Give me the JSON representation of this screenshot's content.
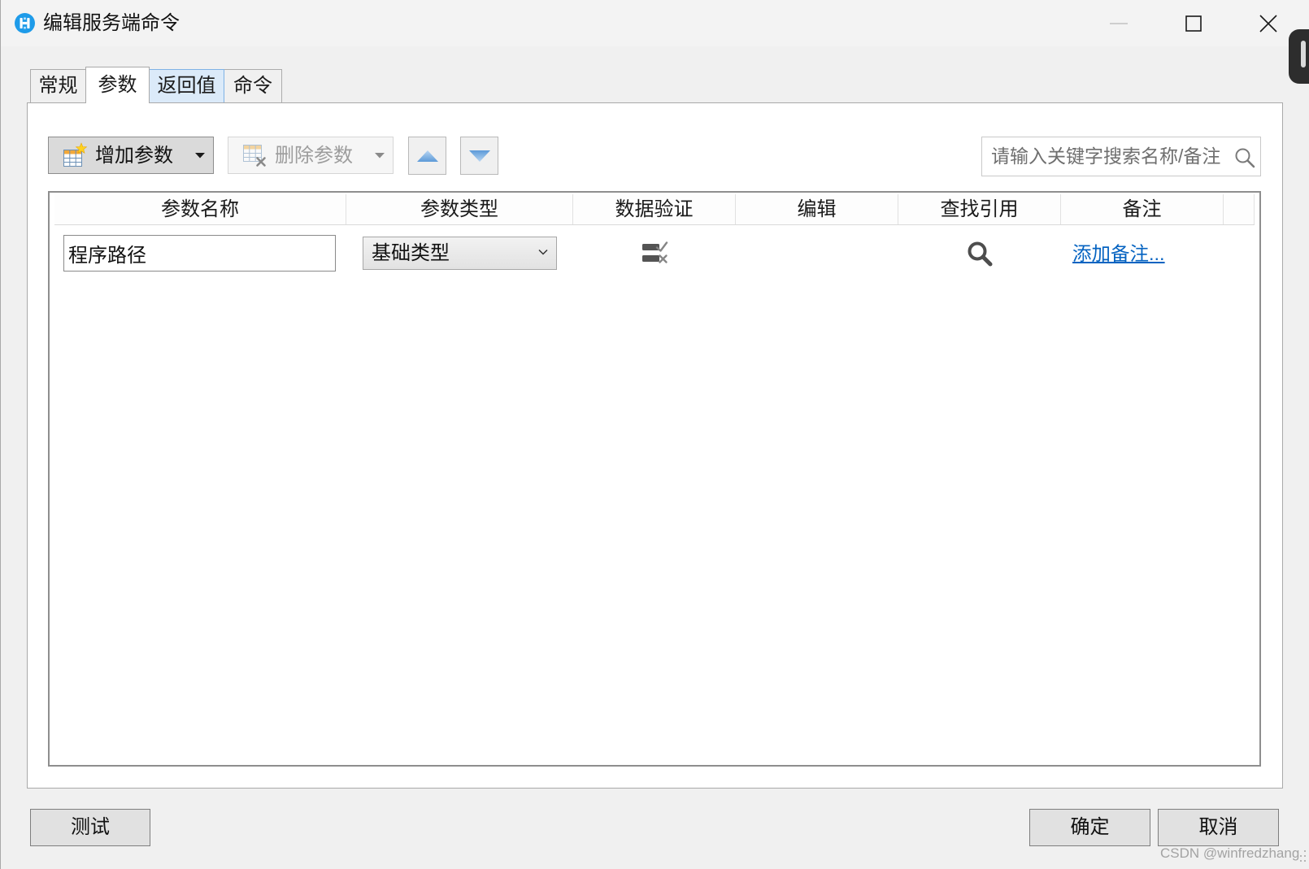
{
  "window": {
    "title": "编辑服务端命令",
    "app_icon": "app-logo-icon",
    "minimize_icon": "minimize-icon",
    "maximize_icon": "maximize-icon",
    "close_icon": "close-icon"
  },
  "tabs": [
    {
      "label": "常规",
      "selected": false,
      "hovered": false
    },
    {
      "label": "参数",
      "selected": true,
      "hovered": false
    },
    {
      "label": "返回值",
      "selected": false,
      "hovered": true
    },
    {
      "label": "命令",
      "selected": false,
      "hovered": false
    }
  ],
  "toolbar": {
    "add_parameter": {
      "label": "增加参数",
      "icon": "table-add-icon",
      "dropdown_icon": "caret-down-icon",
      "disabled": false
    },
    "delete_parameter": {
      "label": "删除参数",
      "icon": "table-delete-icon",
      "dropdown_icon": "caret-down-icon",
      "disabled": true
    },
    "move_up": {
      "icon": "arrow-up-icon"
    },
    "move_down": {
      "icon": "arrow-down-icon"
    },
    "search": {
      "placeholder": "请输入关键字搜索名称/备注",
      "value": "",
      "icon": "search-icon"
    }
  },
  "table": {
    "columns": [
      "参数名称",
      "参数类型",
      "数据验证",
      "编辑",
      "查找引用",
      "备注"
    ],
    "rows": [
      {
        "name": "程序路径",
        "type": "基础类型",
        "type_dropdown_icon": "chevron-down-icon",
        "validation_icon": "validation-rules-icon",
        "find_references_icon": "find-references-icon",
        "note_link": "添加备注..."
      }
    ]
  },
  "footer": {
    "test": "测试",
    "ok": "确定",
    "cancel": "取消"
  },
  "watermark": "CSDN @winfredzhang",
  "colors": {
    "window_bg": "#f0f0f0",
    "titlebar_bg": "#f3f3f3",
    "panel_bg": "#ffffff",
    "tab_hover_bg": "#dbeaf9",
    "tab_hover_border": "#7fb2e5",
    "app_icon_blue": "#1e9be9",
    "arrow_blue": "#5c9ad8",
    "link": "#0563c1",
    "button_bg": "#e1e1e1"
  }
}
